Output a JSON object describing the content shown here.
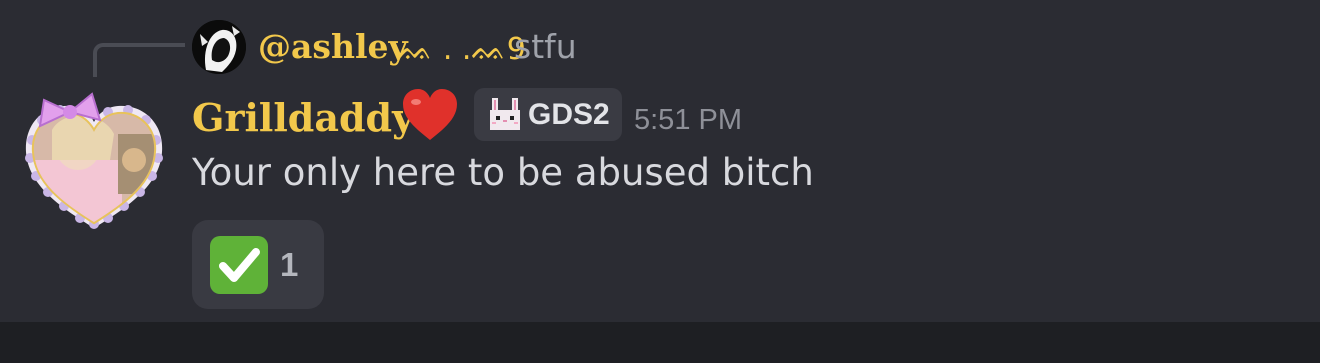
{
  "reply": {
    "author": "@ashley",
    "author_decoration": "ᨐ . .ᨐ9",
    "text": "stfu"
  },
  "message": {
    "author": "Grilldaddy",
    "author_emoji": "heart-icon",
    "tag": {
      "icon": "bunny-icon",
      "label": "GDS2"
    },
    "timestamp": "5:51 PM",
    "body": "Your only here to be abused bitch"
  },
  "reaction": {
    "emoji": "check-mark-icon",
    "count": "1"
  },
  "colors": {
    "background": "#2b2c33",
    "username": "#f2c84b",
    "reaction_bg": "#393a42",
    "check_green": "#5fb238",
    "heart_red": "#e0312b"
  }
}
